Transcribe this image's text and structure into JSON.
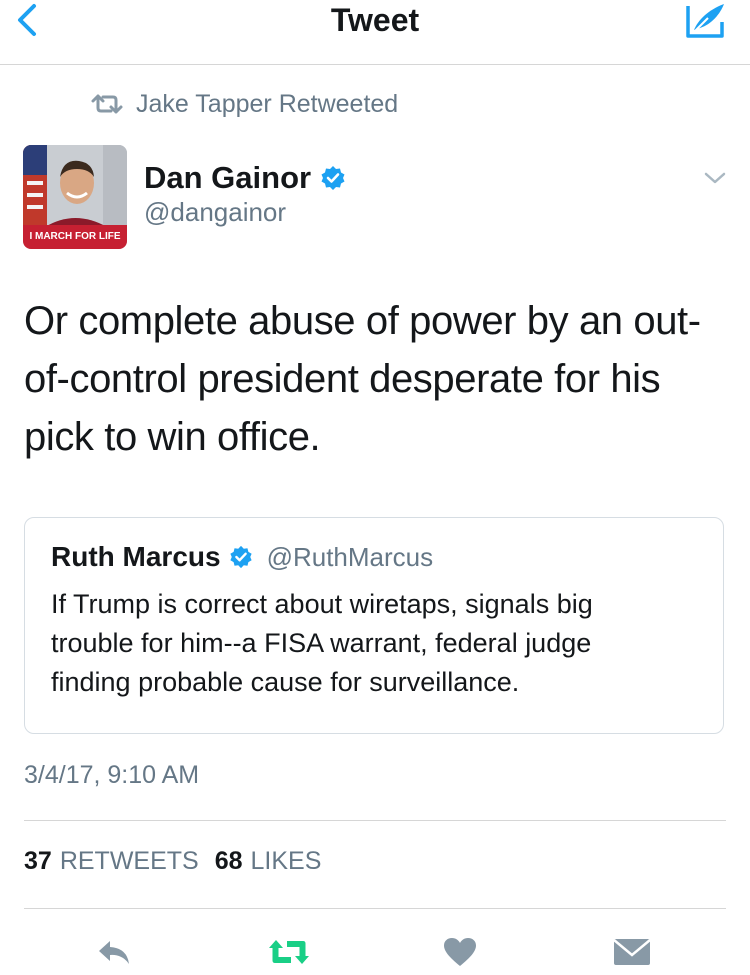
{
  "nav": {
    "title": "Tweet"
  },
  "retweet_context": {
    "text": "Jake Tapper Retweeted"
  },
  "author": {
    "name": "Dan Gainor",
    "handle": "@dangainor",
    "avatar_banner": "I MARCH FOR LIFE"
  },
  "tweet": {
    "lines": [
      "Or complete abuse of power by an out-",
      "of-control president desperate for his",
      "pick to win office."
    ]
  },
  "quoted": {
    "name": "Ruth Marcus",
    "handle": "@RuthMarcus",
    "lines": [
      "If Trump is correct about wiretaps, signals big",
      "trouble for him--a FISA warrant, federal judge",
      "finding probable cause for surveillance."
    ]
  },
  "timestamp": "3/4/17, 9:10 AM",
  "stats": {
    "retweets_count": "37",
    "retweets_label": "RETWEETS",
    "likes_count": "68",
    "likes_label": "LIKES"
  },
  "colors": {
    "accent": "#1da1f2",
    "retweet_green": "#19cf86",
    "secondary_text": "#657786",
    "icon_gray": "#8899a6"
  },
  "icons": [
    "back-chevron-icon",
    "compose-icon",
    "retweet-icon",
    "verified-icon",
    "chevron-down-icon",
    "reply-icon",
    "heart-icon",
    "mail-icon"
  ]
}
